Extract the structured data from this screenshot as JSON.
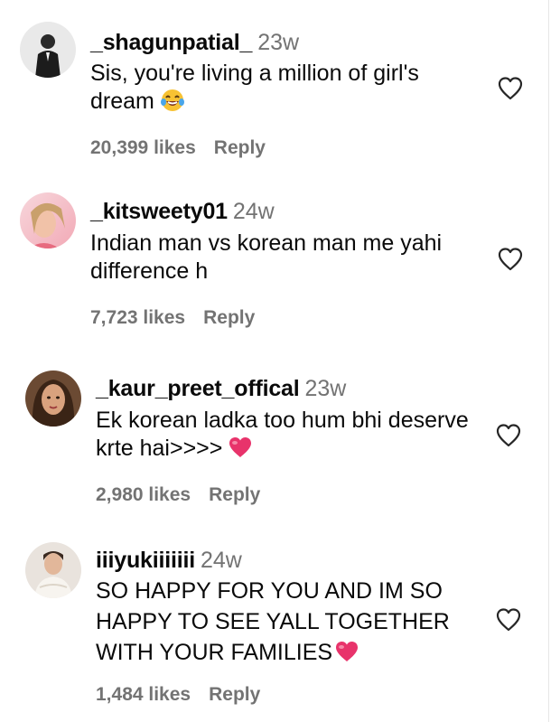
{
  "comments": [
    {
      "username": "_shagunpatial_",
      "time": "23w",
      "text": "Sis, you're living a million of girl's dream",
      "emoji": "laughing-face",
      "likes": "20,399 likes",
      "reply": "Reply"
    },
    {
      "username": "_kitsweety01",
      "time": "24w",
      "text": "Indian man vs korean man me yahi difference h",
      "emoji": "",
      "likes": "7,723 likes",
      "reply": "Reply"
    },
    {
      "username": "_kaur_preet_offical",
      "time": "23w",
      "text": "Ek korean ladka too hum bhi deserve krte hai>>>>",
      "emoji": "heart",
      "likes": "2,980 likes",
      "reply": "Reply"
    },
    {
      "username": "iiiyukiiiiiii",
      "time": "24w",
      "text": "SO HAPPY FOR YOU AND IM SO HAPPY TO SEE YALL TOGETHER WITH YOUR FAMILIES",
      "emoji": "heart",
      "likes": "1,484 likes",
      "reply": "Reply"
    }
  ],
  "colors": {
    "secondary_text": "#737373",
    "primary_text": "#0a0a0a",
    "heart_emoji": "#e8336b"
  }
}
